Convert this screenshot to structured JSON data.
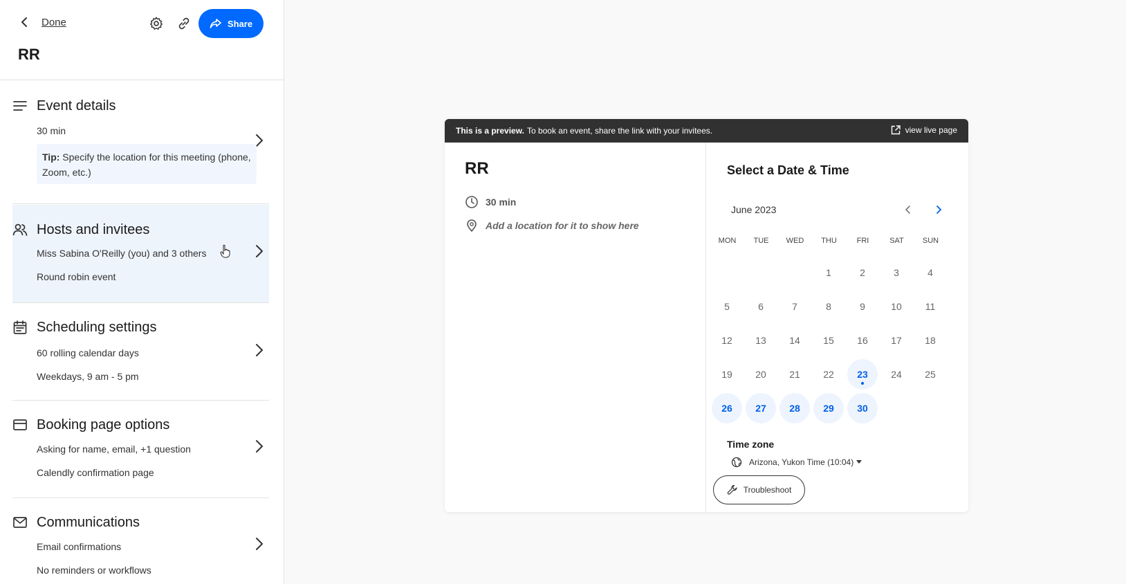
{
  "header": {
    "back_label": "Done",
    "share_label": "Share",
    "event_name": "RR"
  },
  "sidebar": {
    "sections": [
      {
        "title": "Event details",
        "lines": [
          "30 min"
        ],
        "tip_bold": "Tip:",
        "tip_text": "Specify the location for this meeting (phone, Zoom, etc.)",
        "icon": "menu-lines-icon"
      },
      {
        "title": "Hosts and invitees",
        "lines": [
          "Miss Sabina O'Reilly (you) and 3 others",
          "Round robin event"
        ],
        "icon": "people-icon"
      },
      {
        "title": "Scheduling settings",
        "lines": [
          "60 rolling calendar days",
          "Weekdays, 9 am - 5 pm"
        ],
        "icon": "calendar-icon"
      },
      {
        "title": "Booking page options",
        "lines": [
          "Asking for name, email, +1 question",
          "Calendly confirmation page"
        ],
        "icon": "card-icon"
      },
      {
        "title": "Communications",
        "lines": [
          "Email confirmations",
          "No reminders or workflows"
        ],
        "icon": "mail-icon"
      }
    ]
  },
  "preview": {
    "banner_bold": "This is a preview.",
    "banner_text": "To book an event, share the link with your invitees.",
    "view_live": "view live page",
    "event_title": "RR",
    "duration": "30 min",
    "location_hint": "Add a location for it to show here",
    "select_title": "Select a Date & Time",
    "month": "June 2023",
    "weekdays": [
      "MON",
      "TUE",
      "WED",
      "THU",
      "FRI",
      "SAT",
      "SUN"
    ],
    "days": [
      "1",
      "2",
      "3",
      "4",
      "5",
      "6",
      "7",
      "8",
      "9",
      "10",
      "11",
      "12",
      "13",
      "14",
      "15",
      "16",
      "17",
      "18",
      "19",
      "20",
      "21",
      "22",
      "23",
      "24",
      "25",
      "26",
      "27",
      "28",
      "29",
      "30"
    ],
    "available_days": [
      "23",
      "26",
      "27",
      "28",
      "29",
      "30"
    ],
    "today": "23",
    "timezone_label": "Time zone",
    "timezone": "Arizona, Yukon Time (10:04)",
    "troubleshoot": "Troubleshoot"
  },
  "colors": {
    "accent": "#0069ff",
    "banner": "#313131",
    "avail_bg": "#eef4fe"
  }
}
